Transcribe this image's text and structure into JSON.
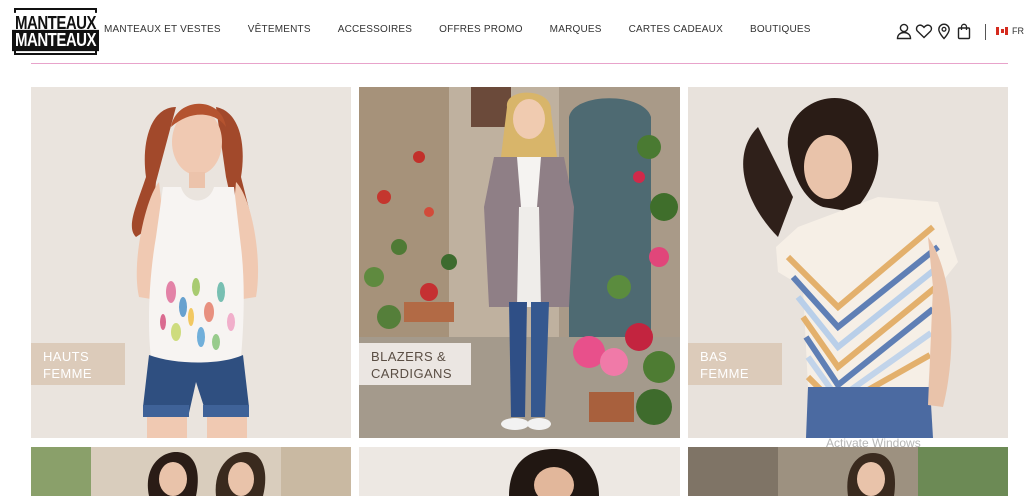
{
  "brand": {
    "logo_line1": "MANTEAUX",
    "logo_line2": "MANTEAUX"
  },
  "nav": {
    "items": [
      {
        "label": "MANTEAUX ET VESTES"
      },
      {
        "label": "VÊTEMENTS"
      },
      {
        "label": "ACCESSOIRES"
      },
      {
        "label": "OFFRES PROMO"
      },
      {
        "label": "MARQUES"
      },
      {
        "label": "CARTES CADEAUX"
      },
      {
        "label": "BOUTIQUES"
      }
    ]
  },
  "header_icons": [
    "user-icon",
    "heart-icon",
    "location-pin-icon",
    "shopping-bag-icon"
  ],
  "language": {
    "code": "FR",
    "flag": "canada-flag-icon"
  },
  "colors": {
    "divider": "#e8a3cb",
    "label_bg": "#dac9b6",
    "text": "#333333"
  },
  "categories": [
    {
      "label": "HAUTS\nFEMME"
    },
    {
      "label": "BLAZERS &\nCARDIGANS"
    },
    {
      "label": "BAS\nFEMME"
    }
  ],
  "os_watermark": "Activate Windows"
}
